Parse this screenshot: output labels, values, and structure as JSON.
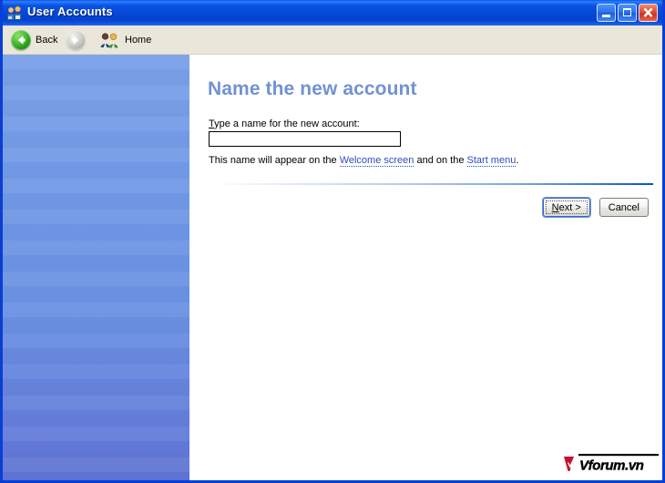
{
  "window": {
    "title": "User Accounts",
    "titlebar_icon": "user-accounts-icon",
    "controls": {
      "minimize": "Minimize",
      "maximize": "Maximize",
      "close": "Close"
    }
  },
  "toolbar": {
    "back_label": "Back",
    "back_icon": "back-arrow-icon",
    "forward_icon": "forward-arrow-icon",
    "home_label": "Home",
    "home_icon": "home-users-icon"
  },
  "content": {
    "page_title": "Name the new account",
    "field_label_accel": "T",
    "field_label_rest": "ype a name for the new account:",
    "name_value": "",
    "name_placeholder": "",
    "description_prefix": "This name will appear on the ",
    "link_welcome": "Welcome screen",
    "description_middle": " and on the ",
    "link_start_menu": "Start menu",
    "description_suffix": "."
  },
  "buttons": {
    "next_accel": "N",
    "next_rest": "ext >",
    "cancel_label": "Cancel"
  },
  "watermark": {
    "text": "Vforum.vn",
    "logo_color": "#c8102e"
  },
  "colors": {
    "titlebar_blue": "#0548d8",
    "window_border": "#0a3fd4",
    "toolbar_beige": "#eae7da",
    "sidebar_blue": "#6a91e2",
    "heading_blue": "#7192d4",
    "link_blue": "#2b4fc4",
    "close_red": "#cc3420"
  }
}
